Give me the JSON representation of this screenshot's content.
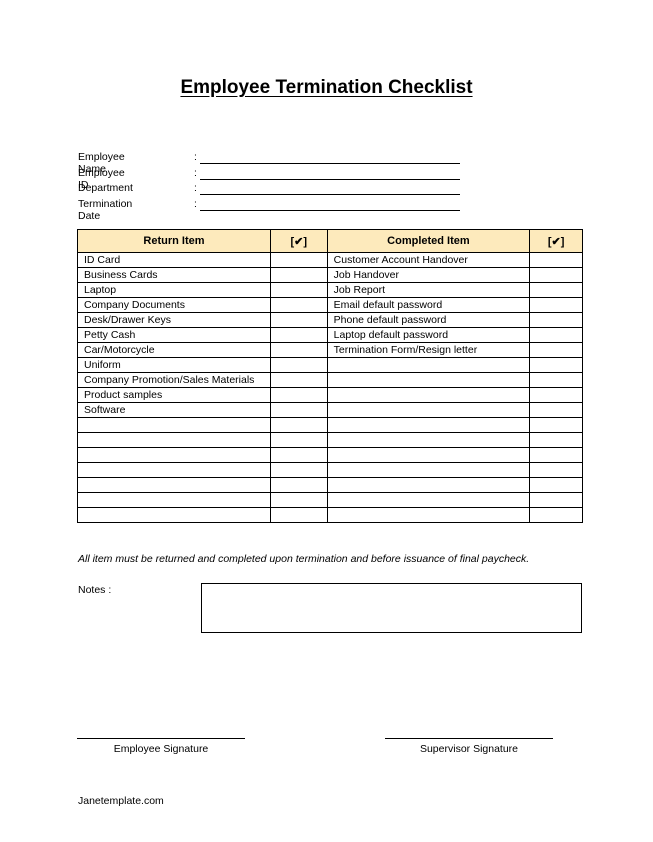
{
  "title": "Employee Termination  Checklist",
  "fields": [
    {
      "label": "Employee Name",
      "colon": ":",
      "value": ""
    },
    {
      "label": "Employee ID",
      "colon": ":",
      "value": ""
    },
    {
      "label": "Department",
      "colon": ":",
      "value": ""
    },
    {
      "label": "Termination Date",
      "colon": ":",
      "value": ""
    }
  ],
  "table": {
    "headers": [
      "Return Item",
      "[✔]",
      "Completed Item",
      "[✔]"
    ],
    "rows": [
      [
        "ID Card",
        "",
        "Customer Account Handover",
        ""
      ],
      [
        "Business Cards",
        "",
        "Job Handover",
        ""
      ],
      [
        "Laptop",
        "",
        "Job Report",
        ""
      ],
      [
        "Company Documents",
        "",
        "Email default password",
        ""
      ],
      [
        "Desk/Drawer Keys",
        "",
        "Phone default password",
        ""
      ],
      [
        "Petty Cash",
        "",
        "Laptop default password",
        ""
      ],
      [
        "Car/Motorcycle",
        "",
        "Termination Form/Resign letter",
        ""
      ],
      [
        "Uniform",
        "",
        "",
        ""
      ],
      [
        "Company Promotion/Sales Materials",
        "",
        "",
        ""
      ],
      [
        "Product samples",
        "",
        "",
        ""
      ],
      [
        "Software",
        "",
        "",
        ""
      ],
      [
        "",
        "",
        "",
        ""
      ],
      [
        "",
        "",
        "",
        ""
      ],
      [
        "",
        "",
        "",
        ""
      ],
      [
        "",
        "",
        "",
        ""
      ],
      [
        "",
        "",
        "",
        ""
      ],
      [
        "",
        "",
        "",
        ""
      ],
      [
        "",
        "",
        "",
        ""
      ]
    ]
  },
  "note": "All item must be returned and completed upon termination and before issuance of final paycheck.",
  "notes_label": "Notes :",
  "signatures": {
    "employee": "Employee Signature",
    "supervisor": "Supervisor Signature"
  },
  "footer": "Janetemplate.com",
  "colors": {
    "header_bg": "#fdeabc"
  }
}
